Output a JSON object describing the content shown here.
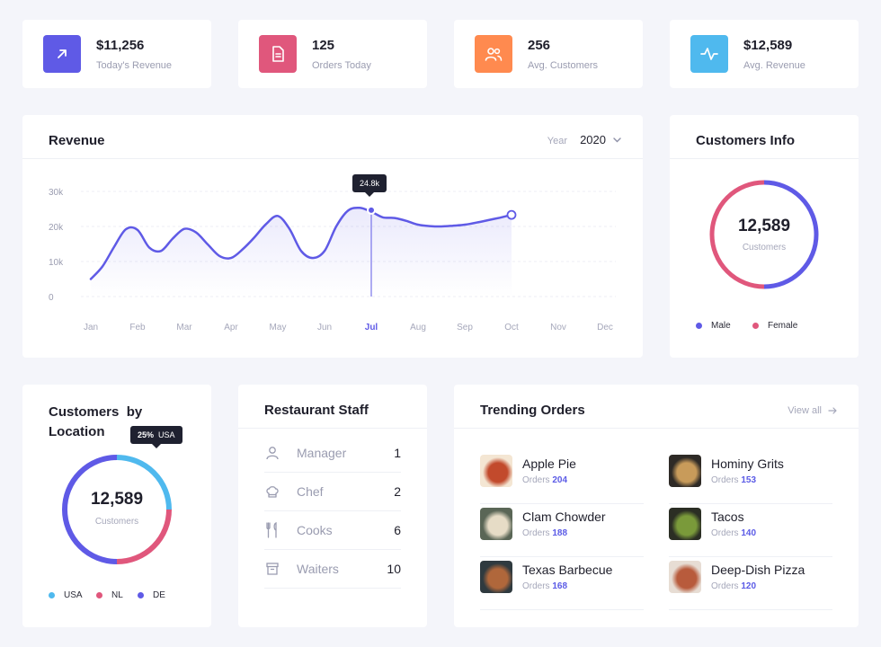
{
  "stats": [
    {
      "value": "$11,256",
      "label": "Today's Revenue",
      "icon": "arrow-up-right-icon",
      "color": "#5f5ae6"
    },
    {
      "value": "125",
      "label": "Orders Today",
      "icon": "document-icon",
      "color": "#e0577c"
    },
    {
      "value": "256",
      "label": "Avg. Customers",
      "icon": "users-icon",
      "color": "#ff8a4f"
    },
    {
      "value": "$12,589",
      "label": "Avg. Revenue",
      "icon": "activity-icon",
      "color": "#4fb9ee"
    }
  ],
  "revenue": {
    "title": "Revenue",
    "year_label": "Year",
    "year_value": "2020",
    "tooltip": "24.8k",
    "chart_data": {
      "type": "area",
      "title": "Revenue",
      "y_ticks": [
        "30k",
        "20k",
        "10k",
        "0"
      ],
      "ylim": [
        0,
        30000
      ],
      "x_labels": [
        "Jan",
        "Feb",
        "Mar",
        "Apr",
        "May",
        "Jun",
        "Jul",
        "Aug",
        "Sep",
        "Oct",
        "Nov",
        "Dec"
      ],
      "active_month": "Jul",
      "grid": true,
      "x": [
        0,
        0.25,
        0.5,
        0.75,
        1,
        1.25,
        1.5,
        1.75,
        2,
        2.25,
        2.5,
        2.75,
        3,
        3.25,
        3.5,
        3.75,
        4,
        4.25,
        4.5,
        4.75,
        5,
        5.25,
        5.5,
        5.75,
        6,
        6.25,
        6.5,
        6.75,
        7,
        7.25,
        7.5,
        7.75,
        8,
        8.25,
        8.5,
        8.75,
        9
      ],
      "values": [
        5000,
        8600,
        14200,
        19200,
        19000,
        14000,
        13000,
        16500,
        19300,
        18300,
        14900,
        11600,
        11000,
        13500,
        16900,
        20700,
        23000,
        19300,
        13000,
        11000,
        13000,
        20000,
        24500,
        25300,
        24200,
        22600,
        22400,
        21600,
        20500,
        20100,
        20000,
        20200,
        20500,
        21100,
        21800,
        22500,
        23300
      ]
    }
  },
  "customers_info": {
    "title": "Customers Info",
    "total": "12,589",
    "total_label": "Customers",
    "chart_data": {
      "type": "pie",
      "labels": [
        "Male",
        "Female"
      ],
      "values": [
        50,
        50
      ],
      "colors": [
        "#5f5ae6",
        "#e0577c"
      ]
    }
  },
  "customers_location": {
    "title_line1": "Customers  by",
    "title_line2": "Location",
    "total": "12,589",
    "total_label": "Customers",
    "tooltip_percent": "25%",
    "tooltip_country": "USA",
    "chart_data": {
      "type": "pie",
      "labels": [
        "USA",
        "NL",
        "DE"
      ],
      "values": [
        25,
        25,
        50
      ],
      "colors": [
        "#4fb9ee",
        "#e0577c",
        "#5f5ae6"
      ]
    }
  },
  "staff": {
    "title": "Restaurant Staff",
    "rows": [
      {
        "name": "Manager",
        "count": "1",
        "icon": "user-icon"
      },
      {
        "name": "Chef",
        "count": "2",
        "icon": "chef-hat-icon"
      },
      {
        "name": "Cooks",
        "count": "6",
        "icon": "utensils-icon"
      },
      {
        "name": "Waiters",
        "count": "10",
        "icon": "archive-box-icon"
      }
    ]
  },
  "trending": {
    "title": "Trending Orders",
    "view_all": "View all",
    "orders_label": "Orders",
    "items": [
      {
        "name": "Apple Pie",
        "orders": "204",
        "icon": "apple-pie-photo-icon",
        "c1": "#f4e6d3",
        "c2": "#c24a2c"
      },
      {
        "name": "Clam Chowder",
        "orders": "188",
        "icon": "clam-chowder-photo-icon",
        "c1": "#5a6656",
        "c2": "#e6dcc6"
      },
      {
        "name": "Texas Barbecue",
        "orders": "168",
        "icon": "texas-barbecue-photo-icon",
        "c1": "#2f3a3f",
        "c2": "#b0673b"
      },
      {
        "name": "Hominy Grits",
        "orders": "153",
        "icon": "hominy-grits-photo-icon",
        "c1": "#2e2a26",
        "c2": "#c89b5a"
      },
      {
        "name": "Tacos",
        "orders": "140",
        "icon": "tacos-photo-icon",
        "c1": "#2b2e24",
        "c2": "#7a9a3a"
      },
      {
        "name": "Deep-Dish Pizza",
        "orders": "120",
        "icon": "deep-dish-pizza-photo-icon",
        "c1": "#e7ddd4",
        "c2": "#b85b3c"
      }
    ]
  }
}
